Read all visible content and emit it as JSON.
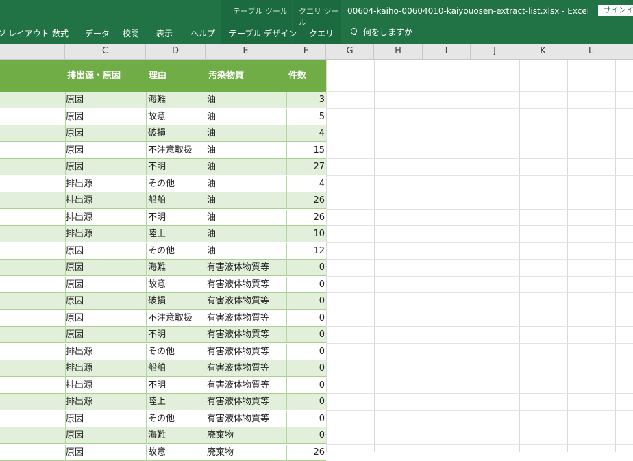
{
  "ribbon": {
    "contextual": {
      "table_tools": "テーブル ツール",
      "query_tools": "クエリ ツール"
    },
    "window_title": "00604-kaiho-00604010-kaiyouosen-extract-list.xlsx - Excel",
    "signin": "サインイン",
    "tabs": [
      "ジ レイアウト",
      "数式",
      "データ",
      "校閲",
      "表示",
      "ヘルプ",
      "テーブル デザイン",
      "クエリ"
    ],
    "tell_me": "何をしますか"
  },
  "columns": [
    "C",
    "D",
    "E",
    "F",
    "G",
    "H",
    "I",
    "J",
    "K",
    "L"
  ],
  "table": {
    "headers": [
      "排出源・原因",
      "理由",
      "汚染物質",
      "件数"
    ],
    "rows": [
      [
        "原因",
        "海難",
        "油",
        "3"
      ],
      [
        "原因",
        "故意",
        "油",
        "5"
      ],
      [
        "原因",
        "破損",
        "油",
        "4"
      ],
      [
        "原因",
        "不注意取扱",
        "油",
        "15"
      ],
      [
        "原因",
        "不明",
        "油",
        "27"
      ],
      [
        "排出源",
        "その他",
        "油",
        "4"
      ],
      [
        "排出源",
        "船舶",
        "油",
        "26"
      ],
      [
        "排出源",
        "不明",
        "油",
        "26"
      ],
      [
        "排出源",
        "陸上",
        "油",
        "10"
      ],
      [
        "原因",
        "その他",
        "油",
        "12"
      ],
      [
        "原因",
        "海難",
        "有害液体物質等",
        "0"
      ],
      [
        "原因",
        "故意",
        "有害液体物質等",
        "0"
      ],
      [
        "原因",
        "破損",
        "有害液体物質等",
        "0"
      ],
      [
        "原因",
        "不注意取扱",
        "有害液体物質等",
        "0"
      ],
      [
        "原因",
        "不明",
        "有害液体物質等",
        "0"
      ],
      [
        "排出源",
        "その他",
        "有害液体物質等",
        "0"
      ],
      [
        "排出源",
        "船舶",
        "有害液体物質等",
        "0"
      ],
      [
        "排出源",
        "不明",
        "有害液体物質等",
        "0"
      ],
      [
        "排出源",
        "陸上",
        "有害液体物質等",
        "0"
      ],
      [
        "原因",
        "その他",
        "有害液体物質等",
        "0"
      ],
      [
        "原因",
        "海難",
        "廃棄物",
        "0"
      ],
      [
        "原因",
        "故意",
        "廃棄物",
        "26"
      ]
    ]
  },
  "colors": {
    "ribbon": "#217346",
    "table_header": "#70ad47",
    "band": "#e2efda"
  }
}
